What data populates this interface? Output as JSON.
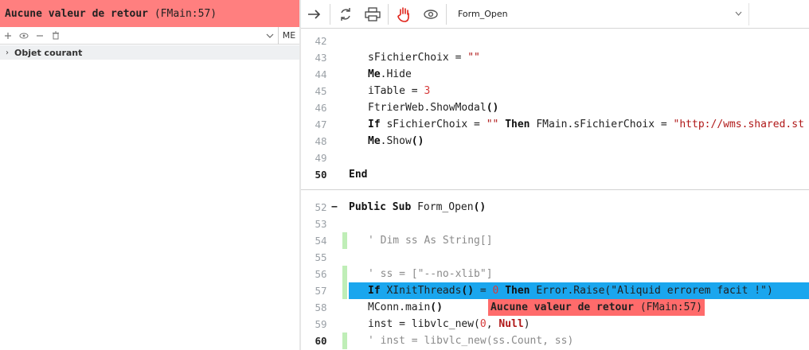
{
  "left_panel": {
    "error_title": "Aucune valeur de retour",
    "error_location": "(FMain:57)",
    "watch_toolbar": {
      "icons": [
        "plus-icon",
        "eye-icon",
        "minus-icon",
        "trash-icon"
      ],
      "me_label": "ME"
    },
    "tree": {
      "item_label": "Objet courant"
    }
  },
  "editor_toolbar": {
    "procedure": "Form_Open",
    "icons": [
      "step-arrow-icon",
      "refresh-icon",
      "printer-icon",
      "hand-stop-icon",
      "eye-icon"
    ],
    "stop_color": "#e0241b"
  },
  "editor": {
    "current_line": "57",
    "lines": [
      {
        "n": "42"
      },
      {
        "n": "43"
      },
      {
        "n": "44"
      },
      {
        "n": "45"
      },
      {
        "n": "46"
      },
      {
        "n": "47"
      },
      {
        "n": "48"
      },
      {
        "n": "49"
      },
      {
        "n": "50"
      },
      {
        "n": "52"
      },
      {
        "n": "53"
      },
      {
        "n": "54"
      },
      {
        "n": "55"
      },
      {
        "n": "56"
      },
      {
        "n": "57"
      },
      {
        "n": "58"
      },
      {
        "n": "59"
      },
      {
        "n": "60"
      }
    ],
    "code": {
      "l43a": "sFichierChoix = ",
      "l43b": "\"\"",
      "l44a": "Me",
      "l44b": ".Hide",
      "l45a": "iTable = ",
      "l45b": "3",
      "l46a": "FtrierWeb.ShowModal",
      "l46b": "()",
      "l47a": "If",
      "l47b": " sFichierChoix = ",
      "l47c": "\"\"",
      "l47d": " Then",
      "l47e": " FMain.sFichierChoix = ",
      "l47f": "\"http://wms.shared.st",
      "l48a": "Me",
      "l48b": ".Show",
      "l48c": "()",
      "l50": "End",
      "l52a": "Public Sub",
      "l52b": " Form_Open",
      "l52c": "()",
      "l54": "' Dim ss As String[]",
      "l56": "' ss = [\"--no-xlib\"]",
      "l57a": "If",
      "l57b": " XInitThreads",
      "l57c": "()",
      "l57d": " = ",
      "l57e": "0",
      "l57f": " Then",
      "l57g": " Error.Raise(",
      "l57h": "\"Aliquid errorem facit !\"",
      "l57i": ")",
      "l58a": "MConn.main",
      "l58b": "()",
      "l59a": "inst = libvlc_new(",
      "l59b": "0",
      "l59c": ", ",
      "l59d": "Null",
      "l59e": ")",
      "l60": "' inst = libvlc_new(ss.Count, ss)"
    },
    "error_popup": {
      "title": "Aucune valeur de retour",
      "location": "(FMain:57)"
    },
    "colors": {
      "current_line_bg": "#1aa6ee",
      "error_bg": "#ff6b6b",
      "string": "#b01818",
      "number": "#d63b3b"
    }
  }
}
